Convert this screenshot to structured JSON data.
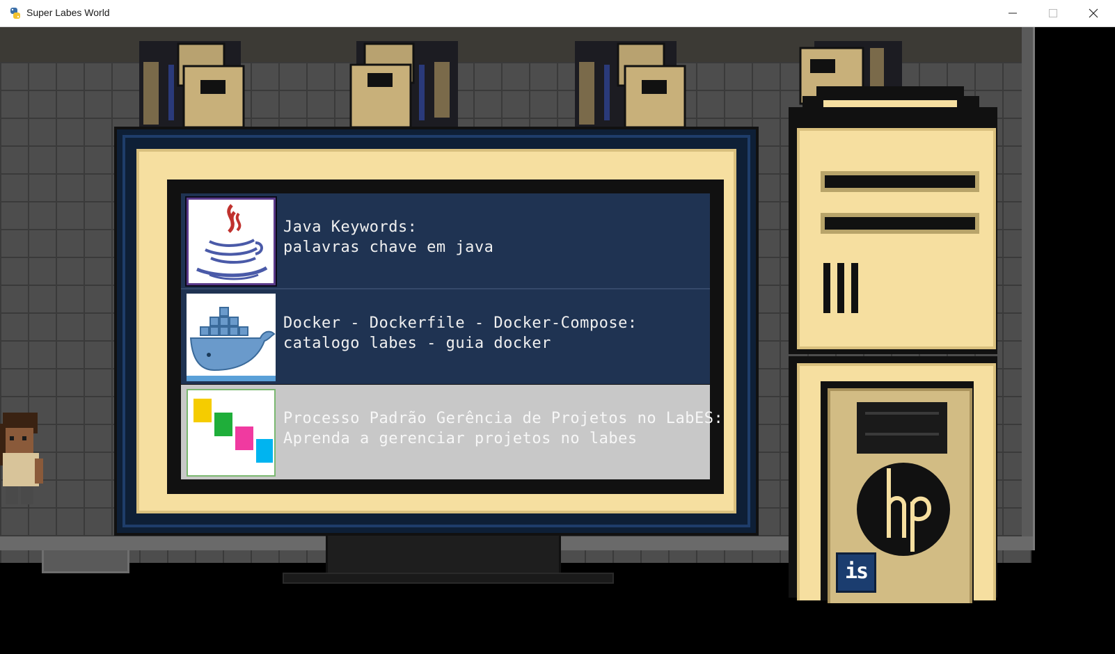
{
  "window": {
    "title": "Super Labes World",
    "controls": {
      "minimize_icon": "minimize-icon",
      "maximize_icon": "maximize-icon",
      "close_icon": "close-icon"
    }
  },
  "game": {
    "monitor_menu": {
      "items": [
        {
          "icon": "java-logo-icon",
          "title": "Java Keywords:",
          "subtitle": "palavras chave em java",
          "selected": false
        },
        {
          "icon": "docker-logo-icon",
          "title": "Docker - Dockerfile - Docker-Compose:",
          "subtitle": "catalogo labes - guia docker",
          "selected": false
        },
        {
          "icon": "colored-squares-icon",
          "title": "Processo Padrão Gerência de Projetos no LabES:",
          "subtitle": "Aprenda a gerenciar projetos no labes",
          "selected": true
        }
      ]
    },
    "tower": {
      "logo": "hp",
      "badge": "is"
    },
    "colors": {
      "menu_item_bg": "#1f3352",
      "menu_selected_bg": "#c8c8c8",
      "bezel_cream": "#f6dfa0",
      "floor": "#4d4d4d"
    }
  }
}
